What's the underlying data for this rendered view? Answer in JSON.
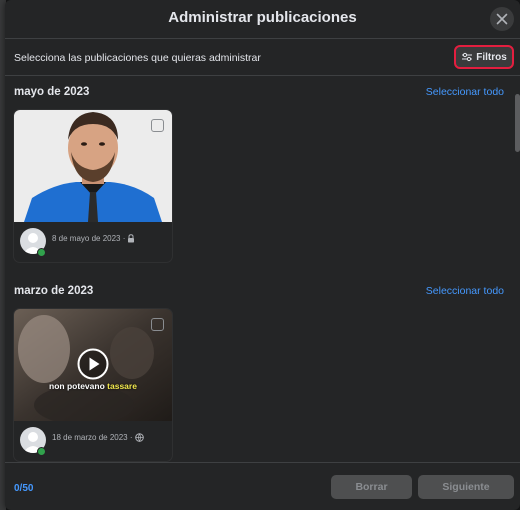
{
  "modal": {
    "title": "Administrar publicaciones",
    "subtitle": "Selecciona las publicaciones que quieras administrar",
    "filters_label": "Filtros"
  },
  "sections": [
    {
      "title": "mayo de 2023",
      "select_all": "Seleccionar todo",
      "post": {
        "date": "8 de mayo de 2023 ·",
        "privacy_icon": "lock-icon",
        "type": "photo"
      }
    },
    {
      "title": "marzo de 2023",
      "select_all": "Seleccionar todo",
      "post": {
        "date": "18 de marzo de 2023 ·",
        "privacy_icon": "globe-icon",
        "type": "video",
        "caption_white": "non potevano",
        "caption_yellow": "tassare"
      }
    }
  ],
  "footer": {
    "count": "0/50",
    "delete_label": "Borrar",
    "next_label": "Siguiente"
  },
  "colors": {
    "accent": "#4599ff",
    "highlight_border": "#e41e3f",
    "online": "#31a24c"
  }
}
